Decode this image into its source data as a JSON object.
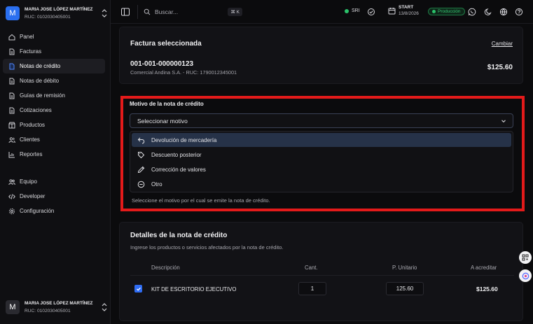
{
  "account": {
    "initial": "M",
    "name": "MARIA JOSE LÓPEZ MARTÍNEZ",
    "ruc": "RUC: 0102030405001"
  },
  "sidebar": {
    "items": [
      {
        "label": "Panel",
        "icon": "home-icon"
      },
      {
        "label": "Facturas",
        "icon": "file-icon"
      },
      {
        "label": "Notas de crédito",
        "icon": "file-icon",
        "active": true
      },
      {
        "label": "Notas de débito",
        "icon": "file-icon"
      },
      {
        "label": "Guías de remisión",
        "icon": "file-icon"
      },
      {
        "label": "Cotizaciones",
        "icon": "file-icon"
      },
      {
        "label": "Productos",
        "icon": "box-icon"
      },
      {
        "label": "Clientes",
        "icon": "users-icon"
      },
      {
        "label": "Reportes",
        "icon": "chart-icon"
      }
    ],
    "bottom_items": [
      {
        "label": "Equipo",
        "icon": "team-icon"
      },
      {
        "label": "Developer",
        "icon": "code-icon"
      },
      {
        "label": "Configuración",
        "icon": "gear-icon"
      }
    ]
  },
  "topbar": {
    "search_placeholder": "Buscar...",
    "shortcut": "⌘ K",
    "sri_label": "SRI",
    "plan_label": "START",
    "plan_date": "13/8/2026",
    "env_label": "Producción"
  },
  "invoice": {
    "title": "Factura seleccionada",
    "change_label": "Cambiar",
    "number": "001-001-000000123",
    "customer": "Comercial Andina S.A. - RUC: 1790012345001",
    "total": "$125.60"
  },
  "motivo": {
    "label": "Motivo de la nota de crédito",
    "selected": "Seleccionar motivo",
    "options": [
      {
        "label": "Devolución de mercadería",
        "icon": "undo-icon"
      },
      {
        "label": "Descuento posterior",
        "icon": "tag-icon"
      },
      {
        "label": "Corrección de valores",
        "icon": "pencil-icon"
      },
      {
        "label": "Otro",
        "icon": "more-icon"
      }
    ],
    "help": "Seleccione el motivo por el cual se emite la nota de crédito."
  },
  "details": {
    "title": "Detalles de la nota de crédito",
    "subtitle": "Ingrese los productos o servicios afectados por la nota de crédito.",
    "columns": [
      "Descripción",
      "Cant.",
      "P. Unitario",
      "A acreditar"
    ],
    "rows": [
      {
        "checked": true,
        "description": "KIT DE ESCRITORIO EJECUTIVO",
        "qty": "1",
        "unit_price": "125.60",
        "amount": "$125.60"
      }
    ]
  },
  "colors": {
    "accent": "#2f6cf2",
    "highlight_border": "#e31a1a",
    "status_green": "#2bc26a"
  }
}
